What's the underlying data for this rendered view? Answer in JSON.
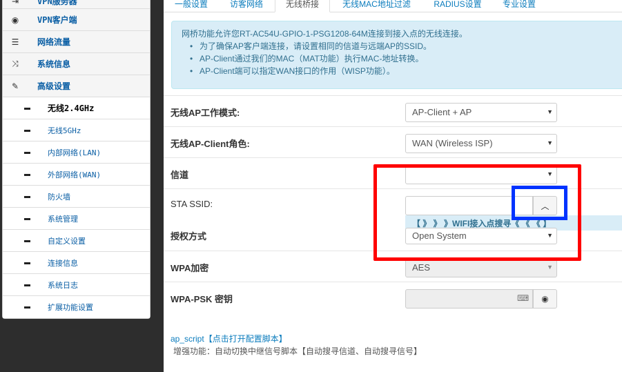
{
  "sidebar": {
    "items": [
      {
        "label": "VPN服务器",
        "icon": "logout-icon"
      },
      {
        "label": "VPN客户端",
        "icon": "globe-icon"
      },
      {
        "label": "网络流量",
        "icon": "list-icon"
      },
      {
        "label": "系统信息",
        "icon": "shuffle-icon"
      },
      {
        "label": "高级设置",
        "icon": "wrench-icon"
      }
    ],
    "subitems": [
      "无线2.4GHz",
      "无线5GHz",
      "内部网络(LAN)",
      "外部网络(WAN)",
      "防火墙",
      "系统管理",
      "自定义设置",
      "连接信息",
      "系统日志",
      "扩展功能设置"
    ]
  },
  "tabs": [
    "一般设置",
    "访客网络",
    "无线桥接",
    "无线MAC地址过滤",
    "RADIUS设置",
    "专业设置"
  ],
  "info": {
    "intro": "网桥功能允许您RT-AC54U-GPIO-1-PSG1208-64M连接到接入点的无线连接。",
    "bullets": [
      "为了确保AP客户端连接，请设置相同的信道与远端AP的SSID。",
      "AP-Client通过我们的MAC（MAT功能）执行MAC-地址转换。",
      "AP-Client端可以指定WAN接口的作用（WISP功能）。"
    ]
  },
  "form": {
    "ap_mode_label": "无线AP工作模式:",
    "ap_mode_value": "AP-Client + AP",
    "client_role_label": "无线AP-Client角色:",
    "client_role_value": "WAN (Wireless ISP)",
    "channel_label": "信道",
    "channel_value": "",
    "ssid_label": "STA SSID:",
    "ssid_value": "",
    "scan_hint": "【 》 》 》WIFI接入点搜寻《 《 《 】",
    "auth_label": "授权方式",
    "auth_value": "Open System",
    "wpa_label": "WPA加密",
    "wpa_value": "AES",
    "psk_label": "WPA-PSK 密钥",
    "psk_value": ""
  },
  "footer": {
    "script_link": "ap_script【点击打开配置脚本】",
    "note": "增强功能：自动切换中继信号脚本【自动搜寻信道、自动搜寻信号】"
  },
  "colors": {
    "highlight_red": "#ff0000",
    "highlight_blue": "#0033ff",
    "accent": "#0b7cbd"
  }
}
